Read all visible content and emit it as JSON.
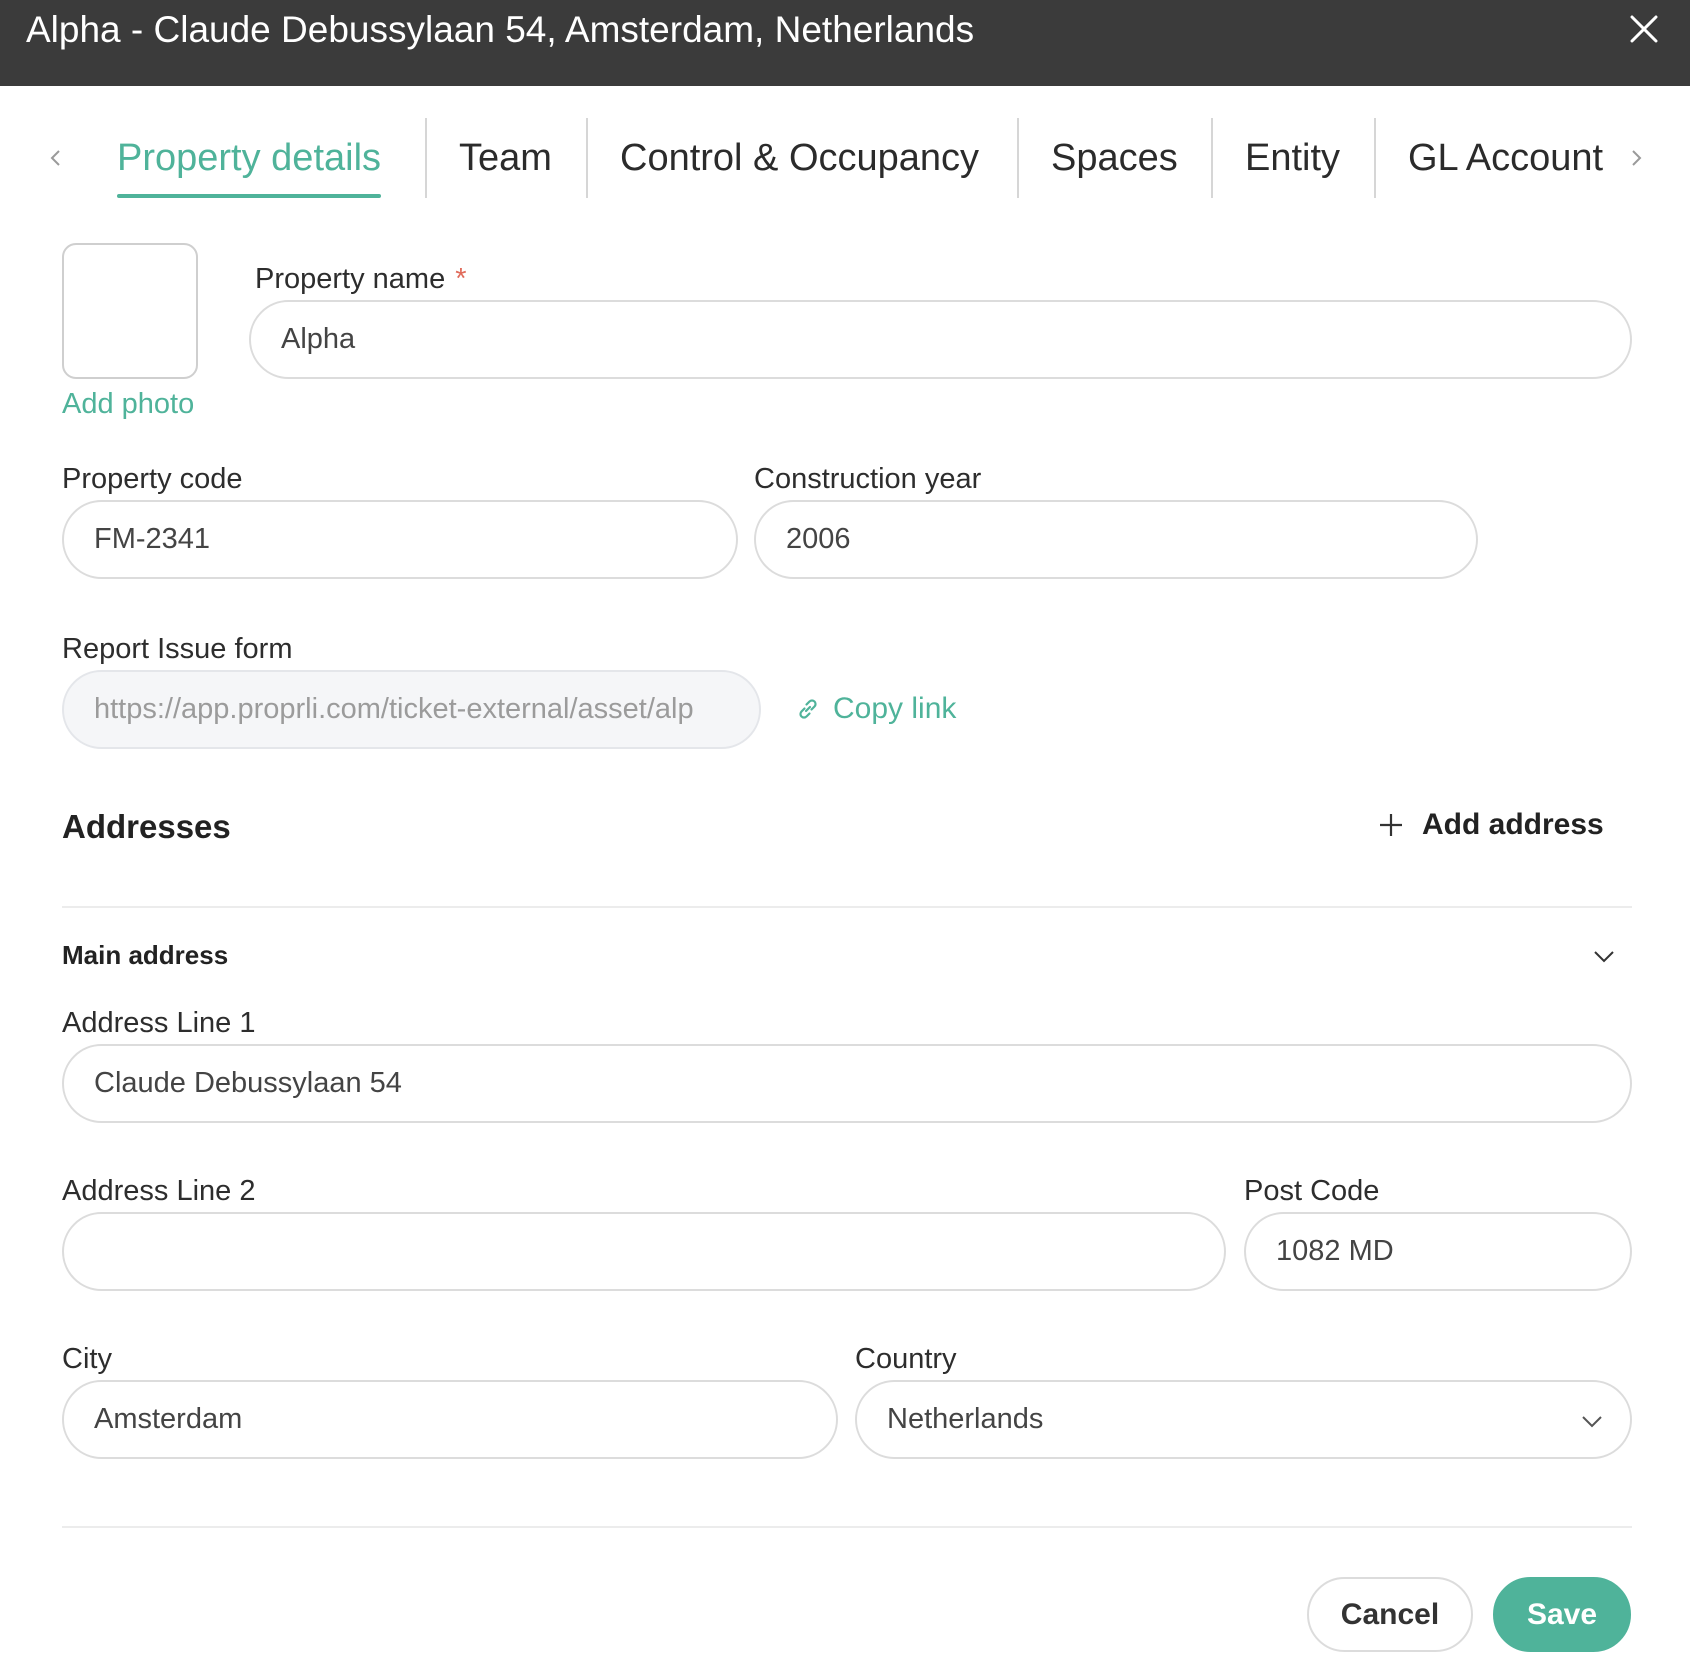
{
  "window": {
    "title": "Alpha - Claude Debussylaan 54, Amsterdam, Netherlands"
  },
  "tabs": [
    {
      "label": "Property details",
      "active": true
    },
    {
      "label": "Team"
    },
    {
      "label": "Control & Occupancy"
    },
    {
      "label": "Spaces"
    },
    {
      "label": "Entity"
    },
    {
      "label": "GL Account"
    }
  ],
  "photo": {
    "add_label": "Add photo"
  },
  "form": {
    "property_name": {
      "label": "Property name",
      "required_mark": "*",
      "value": "Alpha"
    },
    "property_code": {
      "label": "Property code",
      "value": "FM-2341"
    },
    "construction_year": {
      "label": "Construction year",
      "value": "2006"
    },
    "report_issue": {
      "label": "Report Issue form",
      "value": "https://app.proprli.com/ticket-external/asset/alp",
      "copy_label": "Copy link"
    }
  },
  "addresses": {
    "title": "Addresses",
    "add_label": "Add address",
    "main": {
      "title": "Main address",
      "line1": {
        "label": "Address Line 1",
        "value": "Claude Debussylaan 54"
      },
      "line2": {
        "label": "Address Line 2",
        "value": ""
      },
      "post_code": {
        "label": "Post Code",
        "value": "1082 MD"
      },
      "city": {
        "label": "City",
        "value": "Amsterdam"
      },
      "country": {
        "label": "Country",
        "value": "Netherlands"
      }
    }
  },
  "actions": {
    "cancel": "Cancel",
    "save": "Save"
  },
  "colors": {
    "accent": "#4fb39a",
    "titlebar": "#3b3b3b",
    "required": "#e06a5a"
  }
}
